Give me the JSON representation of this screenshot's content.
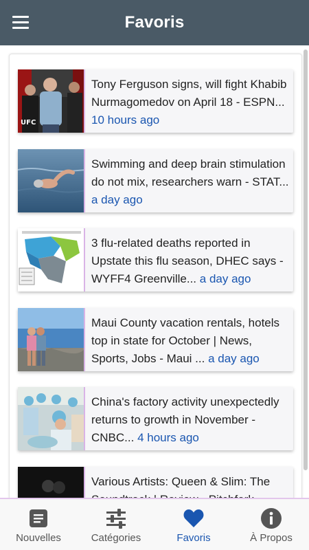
{
  "app": {
    "title": "Favoris"
  },
  "articles": [
    {
      "title": "Tony Ferguson signs, will fight Khabib Nurmagomedov on April 18 - ESPN...",
      "time": "10 hours ago"
    },
    {
      "title": "Swimming and deep brain stimulation do not mix, researchers warn - STAT...",
      "time": "a day ago"
    },
    {
      "title": "3 flu-related deaths reported in Upstate this flu season, DHEC says - WYFF4 Greenville...",
      "time": "a day ago"
    },
    {
      "title": "Maui County vacation rentals, hotels top in state for October | News, Sports, Jobs - Maui ...",
      "time": "a day ago"
    },
    {
      "title": "China's factory activity unexpectedly returns to growth in November - CNBC...",
      "time": "4 hours ago"
    },
    {
      "title": "Various Artists: Queen & Slim: The Soundtrack | Review - Pitchfork...",
      "time": ""
    }
  ],
  "nav": [
    {
      "label": "Nouvelles",
      "icon": "news-icon"
    },
    {
      "label": "Catégories",
      "icon": "sliders-icon"
    },
    {
      "label": "Favoris",
      "icon": "heart-icon"
    },
    {
      "label": "À Propos",
      "icon": "info-icon"
    }
  ],
  "colors": {
    "appbar": "#4a5a66",
    "accent": "#1a56b0",
    "divider": "#d9b3e6"
  }
}
